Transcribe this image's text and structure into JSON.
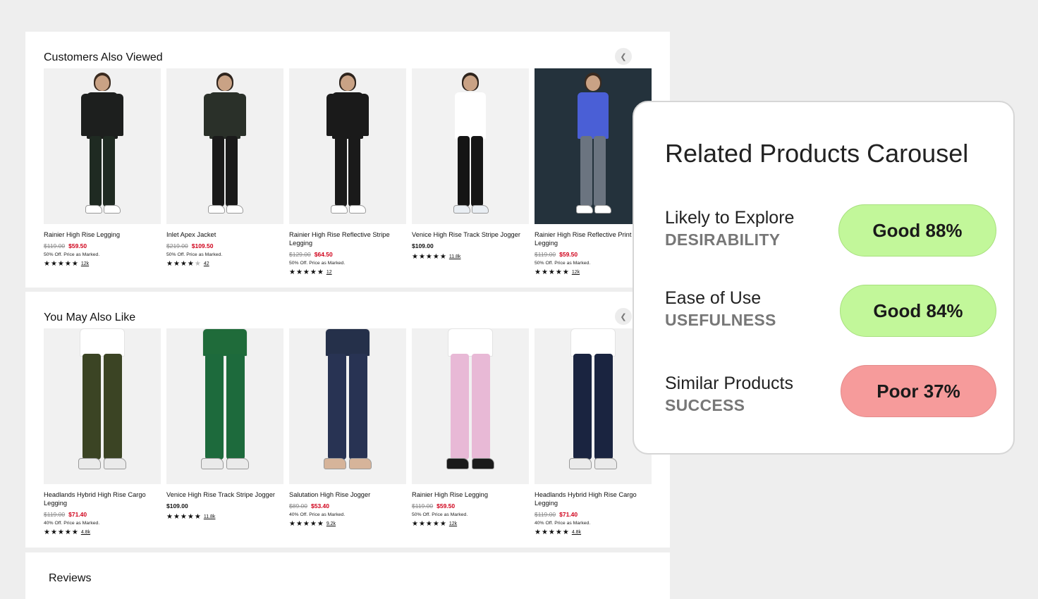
{
  "customers_also_viewed": {
    "title": "Customers Also Viewed",
    "prev_icon": "chevron-left-icon",
    "products": [
      {
        "name": "Rainier High Rise Legging",
        "old_price": "$119.00",
        "price": "$59.50",
        "promo": "50% Off. Price as Marked.",
        "stars": 5,
        "reviews": "12k",
        "sale": true
      },
      {
        "name": "Inlet Apex Jacket",
        "old_price": "$219.00",
        "price": "$109.50",
        "promo": "50% Off. Price as Marked.",
        "stars": 4,
        "reviews": "42",
        "sale": true
      },
      {
        "name": "Rainier High Rise Reflective Stripe Legging",
        "old_price": "$129.00",
        "price": "$64.50",
        "promo": "50% Off. Price as Marked.",
        "stars": 5,
        "reviews": "12",
        "sale": true
      },
      {
        "name": "Venice High Rise Track Stripe Jogger",
        "old_price": "",
        "price": "$109.00",
        "promo": "",
        "stars": 5,
        "reviews": "11.8k",
        "sale": false
      },
      {
        "name": "Rainier High Rise Reflective Print Legging",
        "old_price": "$119.00",
        "price": "$59.50",
        "promo": "50% Off. Price as Marked.",
        "stars": 5,
        "reviews": "12k",
        "sale": true
      }
    ]
  },
  "you_may_also_like": {
    "title": "You May Also Like",
    "prev_icon": "chevron-left-icon",
    "products": [
      {
        "name": "Headlands Hybrid High Rise Cargo Legging",
        "old_price": "$119.00",
        "price": "$71.40",
        "promo": "40% Off. Price as Marked.",
        "stars": 5,
        "reviews": "4.8k",
        "sale": true
      },
      {
        "name": "Venice High Rise Track Stripe Jogger",
        "old_price": "",
        "price": "$109.00",
        "promo": "",
        "stars": 5,
        "reviews": "11.8k",
        "sale": false
      },
      {
        "name": "Salutation High Rise Jogger",
        "old_price": "$89.00",
        "price": "$53.40",
        "promo": "40% Off. Price as Marked.",
        "stars": 5,
        "reviews": "9.2k",
        "sale": true
      },
      {
        "name": "Rainier High Rise Legging",
        "old_price": "$119.00",
        "price": "$59.50",
        "promo": "50% Off. Price as Marked.",
        "stars": 5,
        "reviews": "12k",
        "sale": true
      },
      {
        "name": "Headlands Hybrid High Rise Cargo Legging",
        "old_price": "$119.00",
        "price": "$71.40",
        "promo": "40% Off. Price as Marked.",
        "stars": 5,
        "reviews": "4.8k",
        "sale": true
      }
    ]
  },
  "reviews": {
    "title": "Reviews"
  },
  "score_card": {
    "title": "Related Products Carousel",
    "metrics": [
      {
        "label": "Likely to Explore",
        "category": "DESIRABILITY",
        "score": "Good 88%",
        "status": "good"
      },
      {
        "label": "Ease of Use",
        "category": "USEFULNESS",
        "score": "Good 84%",
        "status": "good"
      },
      {
        "label": "Similar Products",
        "category": "SUCCESS",
        "score": "Poor 37%",
        "status": "poor"
      }
    ]
  },
  "colors": {
    "sale": "#d0021b",
    "good": "#c2f79a",
    "poor": "#f69b9b"
  }
}
